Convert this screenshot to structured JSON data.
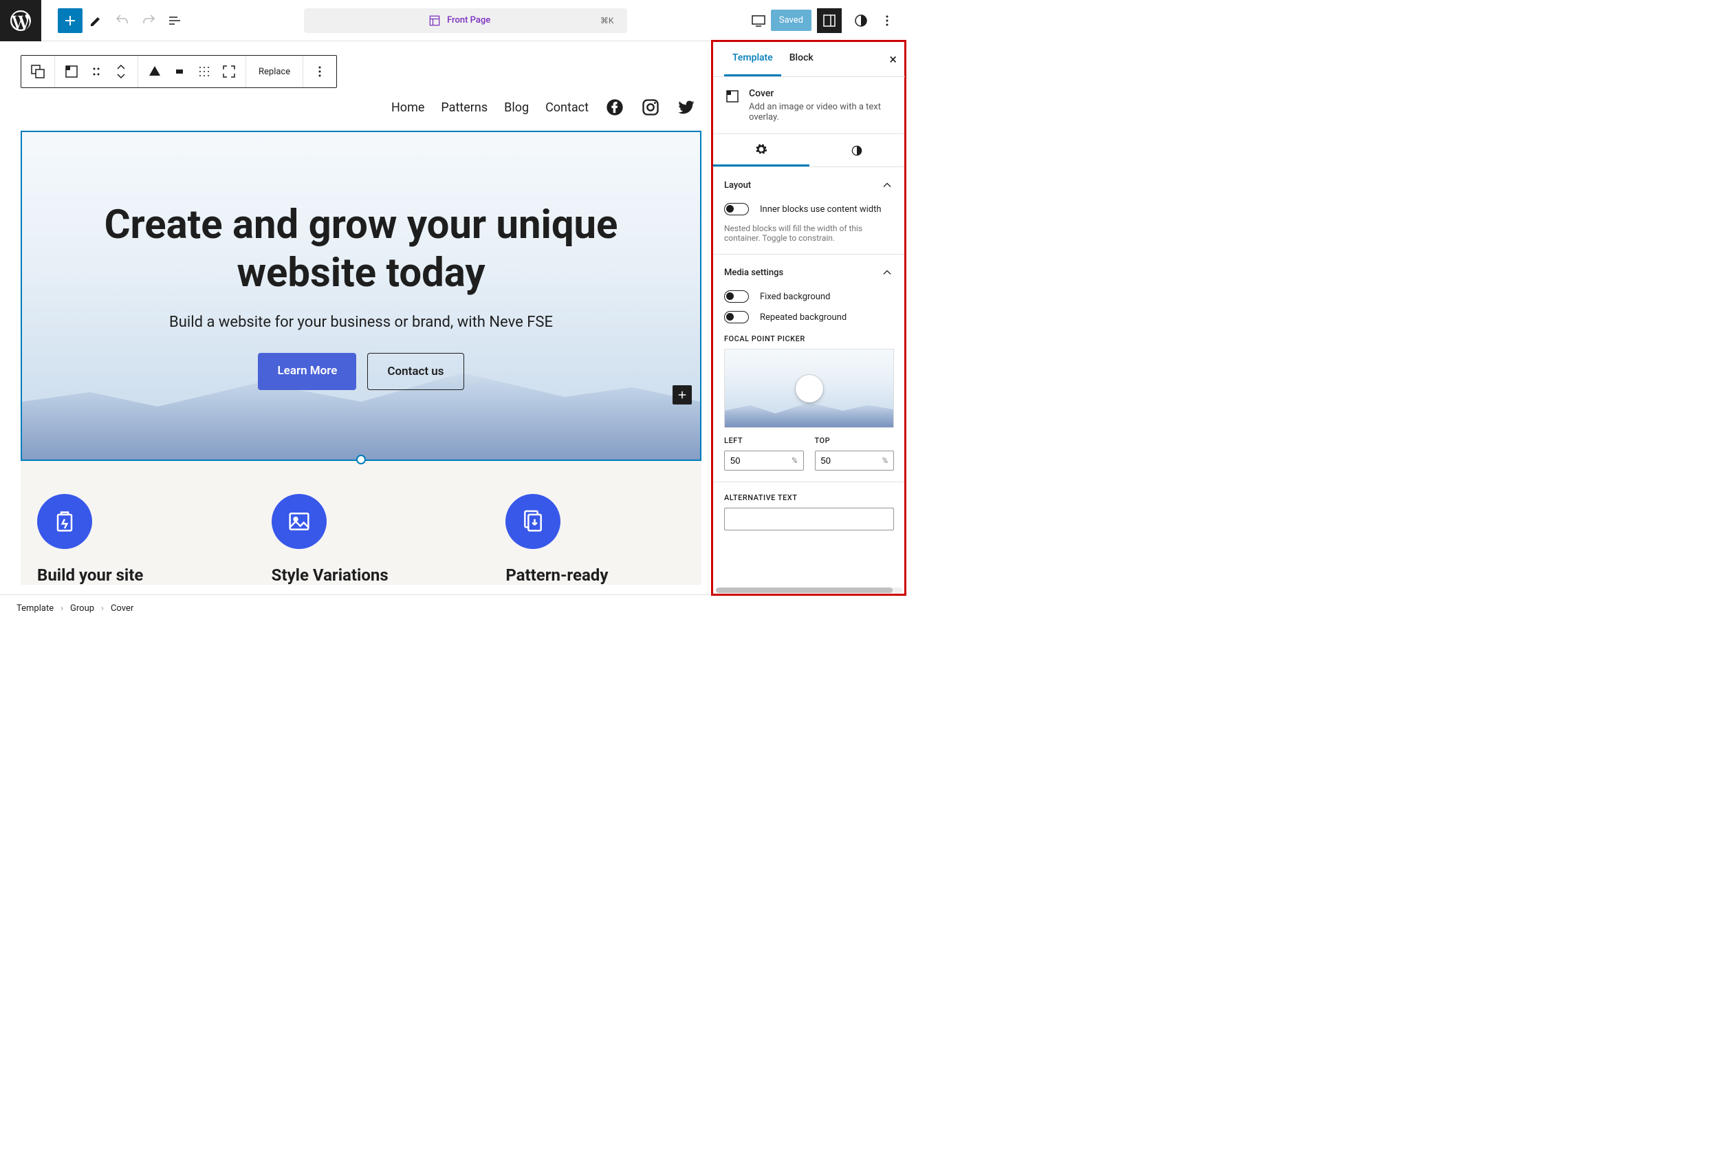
{
  "topbar": {
    "doc_title": "Front Page",
    "shortcut": "⌘K",
    "saved_label": "Saved"
  },
  "block_toolbar": {
    "replace_label": "Replace"
  },
  "nav": {
    "items": [
      "Home",
      "Patterns",
      "Blog",
      "Contact"
    ]
  },
  "cover": {
    "heading": "Create and grow your unique website today",
    "subtitle": "Build a website for your business or brand, with Neve FSE",
    "primary_btn": "Learn More",
    "secondary_btn": "Contact us"
  },
  "features": [
    {
      "title": "Build your site"
    },
    {
      "title": "Style Variations"
    },
    {
      "title": "Pattern-ready"
    }
  ],
  "sidebar": {
    "tabs": {
      "template": "Template",
      "block": "Block"
    },
    "block_name": "Cover",
    "block_desc": "Add an image or video with a text overlay.",
    "panels": {
      "layout": {
        "title": "Layout",
        "toggle_label": "Inner blocks use content width",
        "help": "Nested blocks will fill the width of this container. Toggle to constrain."
      },
      "media": {
        "title": "Media settings",
        "fixed_bg": "Fixed background",
        "repeated_bg": "Repeated background",
        "focal_label": "FOCAL POINT PICKER",
        "left_label": "LEFT",
        "top_label": "TOP",
        "left_value": "50",
        "top_value": "50",
        "unit": "%"
      },
      "alt": {
        "label": "ALTERNATIVE TEXT"
      }
    }
  },
  "breadcrumb": [
    "Template",
    "Group",
    "Cover"
  ]
}
